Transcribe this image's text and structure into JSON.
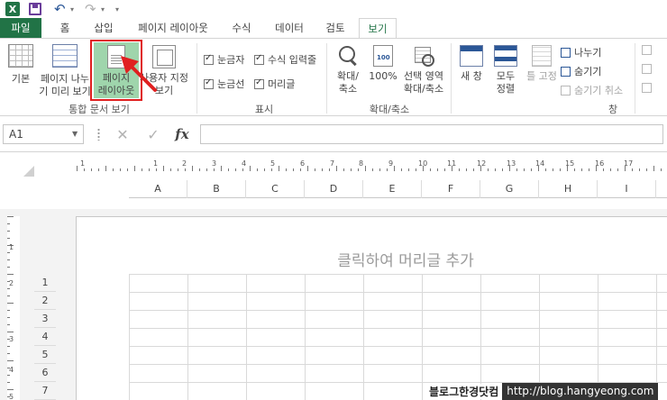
{
  "qat": {
    "app_logo": "X"
  },
  "tabs": [
    {
      "label": "파일"
    },
    {
      "label": "홈"
    },
    {
      "label": "삽입"
    },
    {
      "label": "페이지 레이아웃"
    },
    {
      "label": "수식"
    },
    {
      "label": "데이터"
    },
    {
      "label": "검토"
    },
    {
      "label": "보기"
    }
  ],
  "ribbon": {
    "workbook_views": {
      "normal": "기본",
      "page_break_1": "페이지 나누",
      "page_break_2": "기 미리 보기",
      "page_layout_1": "페이지",
      "page_layout_2": "레이아웃",
      "custom_1": "사용자 지정",
      "custom_2": "보기",
      "group": "통합 문서 보기"
    },
    "show": {
      "ruler": "눈금자",
      "formula_bar": "수식 입력줄",
      "gridlines": "눈금선",
      "headings": "머리글",
      "group": "표시"
    },
    "zoom": {
      "zoom_1": "확대/",
      "zoom_2": "축소",
      "hundred": "100%",
      "sel_1": "선택 영역",
      "sel_2": "확대/축소",
      "group": "확대/축소"
    },
    "window": {
      "new_window": "새 창",
      "arrange_1": "모두",
      "arrange_2": "정렬",
      "freeze": "틀 고정",
      "split": "나누기",
      "hide": "숨기기",
      "unhide": "숨기기 취소",
      "group": "창"
    }
  },
  "formula_bar": {
    "name_box": "A1",
    "fx": "fx"
  },
  "columns": [
    "A",
    "B",
    "C",
    "D",
    "E",
    "F",
    "G",
    "H",
    "I"
  ],
  "rows": [
    "1",
    "2",
    "3",
    "4",
    "5",
    "6",
    "7"
  ],
  "ruler_numbers": [
    "1",
    "1",
    "2",
    "3",
    "4",
    "5",
    "6",
    "7",
    "8",
    "9",
    "10",
    "11",
    "12",
    "13",
    "14",
    "15",
    "16",
    "17"
  ],
  "vruler_numbers": [
    "1",
    "2",
    "3",
    "4",
    "5"
  ],
  "page": {
    "header_hint": "클릭하여 머리글 추가"
  },
  "watermark": {
    "name": "블로그한경닷컴",
    "url": "http://blog.hangyeong.com"
  },
  "colors": {
    "excel_green": "#217346",
    "highlight_red": "#e02020",
    "active_button": "#9fd5ac"
  }
}
